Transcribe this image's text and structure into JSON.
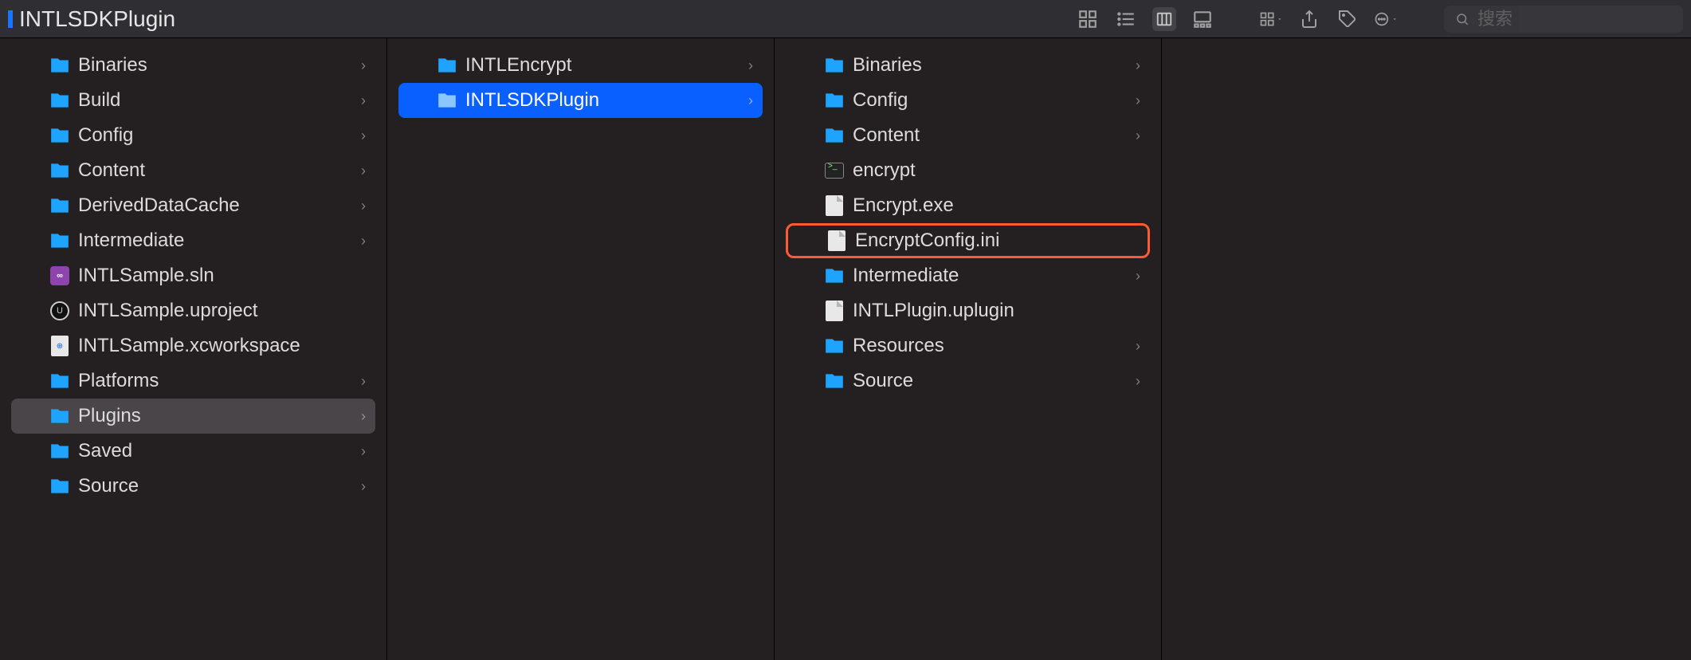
{
  "toolbar": {
    "title": "INTLSDKPlugin",
    "search_placeholder": "搜索"
  },
  "columns": [
    {
      "items": [
        {
          "type": "folder",
          "label": "Binaries",
          "hasChildren": true
        },
        {
          "type": "folder",
          "label": "Build",
          "hasChildren": true
        },
        {
          "type": "folder",
          "label": "Config",
          "hasChildren": true
        },
        {
          "type": "folder",
          "label": "Content",
          "hasChildren": true
        },
        {
          "type": "folder",
          "label": "DerivedDataCache",
          "hasChildren": true
        },
        {
          "type": "folder",
          "label": "Intermediate",
          "hasChildren": true
        },
        {
          "type": "vs",
          "label": "INTLSample.sln",
          "hasChildren": false
        },
        {
          "type": "ue",
          "label": "INTLSample.uproject",
          "hasChildren": false
        },
        {
          "type": "xc",
          "label": "INTLSample.xcworkspace",
          "hasChildren": false
        },
        {
          "type": "folder",
          "label": "Platforms",
          "hasChildren": true
        },
        {
          "type": "folder",
          "label": "Plugins",
          "hasChildren": true,
          "selected": "gray"
        },
        {
          "type": "folder",
          "label": "Saved",
          "hasChildren": true
        },
        {
          "type": "folder",
          "label": "Source",
          "hasChildren": true
        }
      ]
    },
    {
      "items": [
        {
          "type": "folder",
          "label": "INTLEncrypt",
          "hasChildren": true
        },
        {
          "type": "folder",
          "label": "INTLSDKPlugin",
          "hasChildren": true,
          "selected": "blue"
        }
      ]
    },
    {
      "items": [
        {
          "type": "folder",
          "label": "Binaries",
          "hasChildren": true
        },
        {
          "type": "folder",
          "label": "Config",
          "hasChildren": true
        },
        {
          "type": "folder",
          "label": "Content",
          "hasChildren": true
        },
        {
          "type": "term",
          "label": "encrypt",
          "hasChildren": false
        },
        {
          "type": "file",
          "label": "Encrypt.exe",
          "hasChildren": false
        },
        {
          "type": "file",
          "label": "EncryptConfig.ini",
          "hasChildren": false,
          "highlight": true
        },
        {
          "type": "folder",
          "label": "Intermediate",
          "hasChildren": true
        },
        {
          "type": "file",
          "label": "INTLPlugin.uplugin",
          "hasChildren": false
        },
        {
          "type": "folder",
          "label": "Resources",
          "hasChildren": true
        },
        {
          "type": "folder",
          "label": "Source",
          "hasChildren": true
        }
      ]
    },
    {
      "items": []
    }
  ]
}
